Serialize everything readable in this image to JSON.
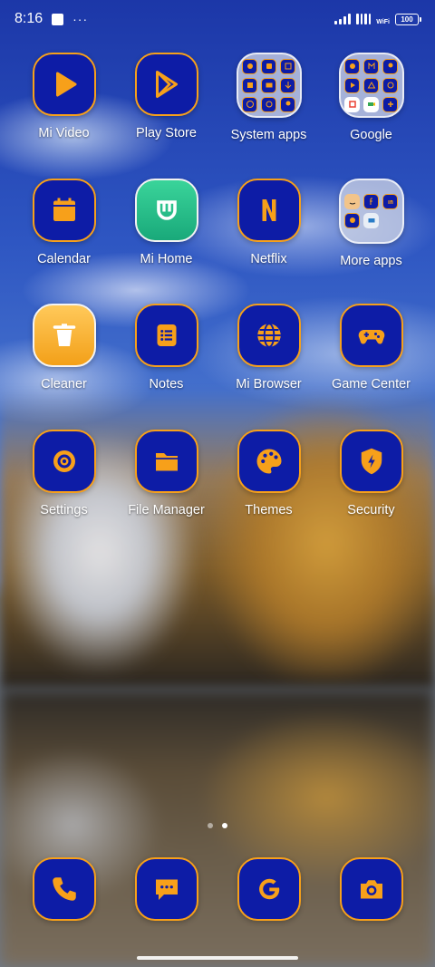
{
  "status_bar": {
    "time": "8:16",
    "notif_dots": "···",
    "wifi_label": "WiFi",
    "battery": "100"
  },
  "colors": {
    "icon_bg": "#0d1ca6",
    "icon_border": "#f7a01a",
    "glyph": "#f7a01a"
  },
  "apps": [
    {
      "label": "Mi Video",
      "icon": "play-icon"
    },
    {
      "label": "Play Store",
      "icon": "play-store-icon"
    },
    {
      "label": "System apps",
      "icon": "folder"
    },
    {
      "label": "Google",
      "icon": "folder"
    },
    {
      "label": "Calendar",
      "icon": "calendar-icon"
    },
    {
      "label": "Mi Home",
      "icon": "mi-home-icon"
    },
    {
      "label": "Netflix",
      "icon": "netflix-icon"
    },
    {
      "label": "More apps",
      "icon": "folder"
    },
    {
      "label": "Cleaner",
      "icon": "trash-icon"
    },
    {
      "label": "Notes",
      "icon": "notes-icon"
    },
    {
      "label": "Mi Browser",
      "icon": "globe-icon"
    },
    {
      "label": "Game Center",
      "icon": "gamepad-icon"
    },
    {
      "label": "Settings",
      "icon": "gear-icon"
    },
    {
      "label": "File Manager",
      "icon": "folder-icon"
    },
    {
      "label": "Themes",
      "icon": "palette-icon"
    },
    {
      "label": "Security",
      "icon": "shield-icon"
    }
  ],
  "pager": {
    "pages": 2,
    "active": 2
  },
  "dock": [
    {
      "name": "phone",
      "icon": "phone-icon"
    },
    {
      "name": "messages",
      "icon": "message-icon"
    },
    {
      "name": "google",
      "icon": "google-g-icon"
    },
    {
      "name": "camera",
      "icon": "camera-icon"
    }
  ]
}
